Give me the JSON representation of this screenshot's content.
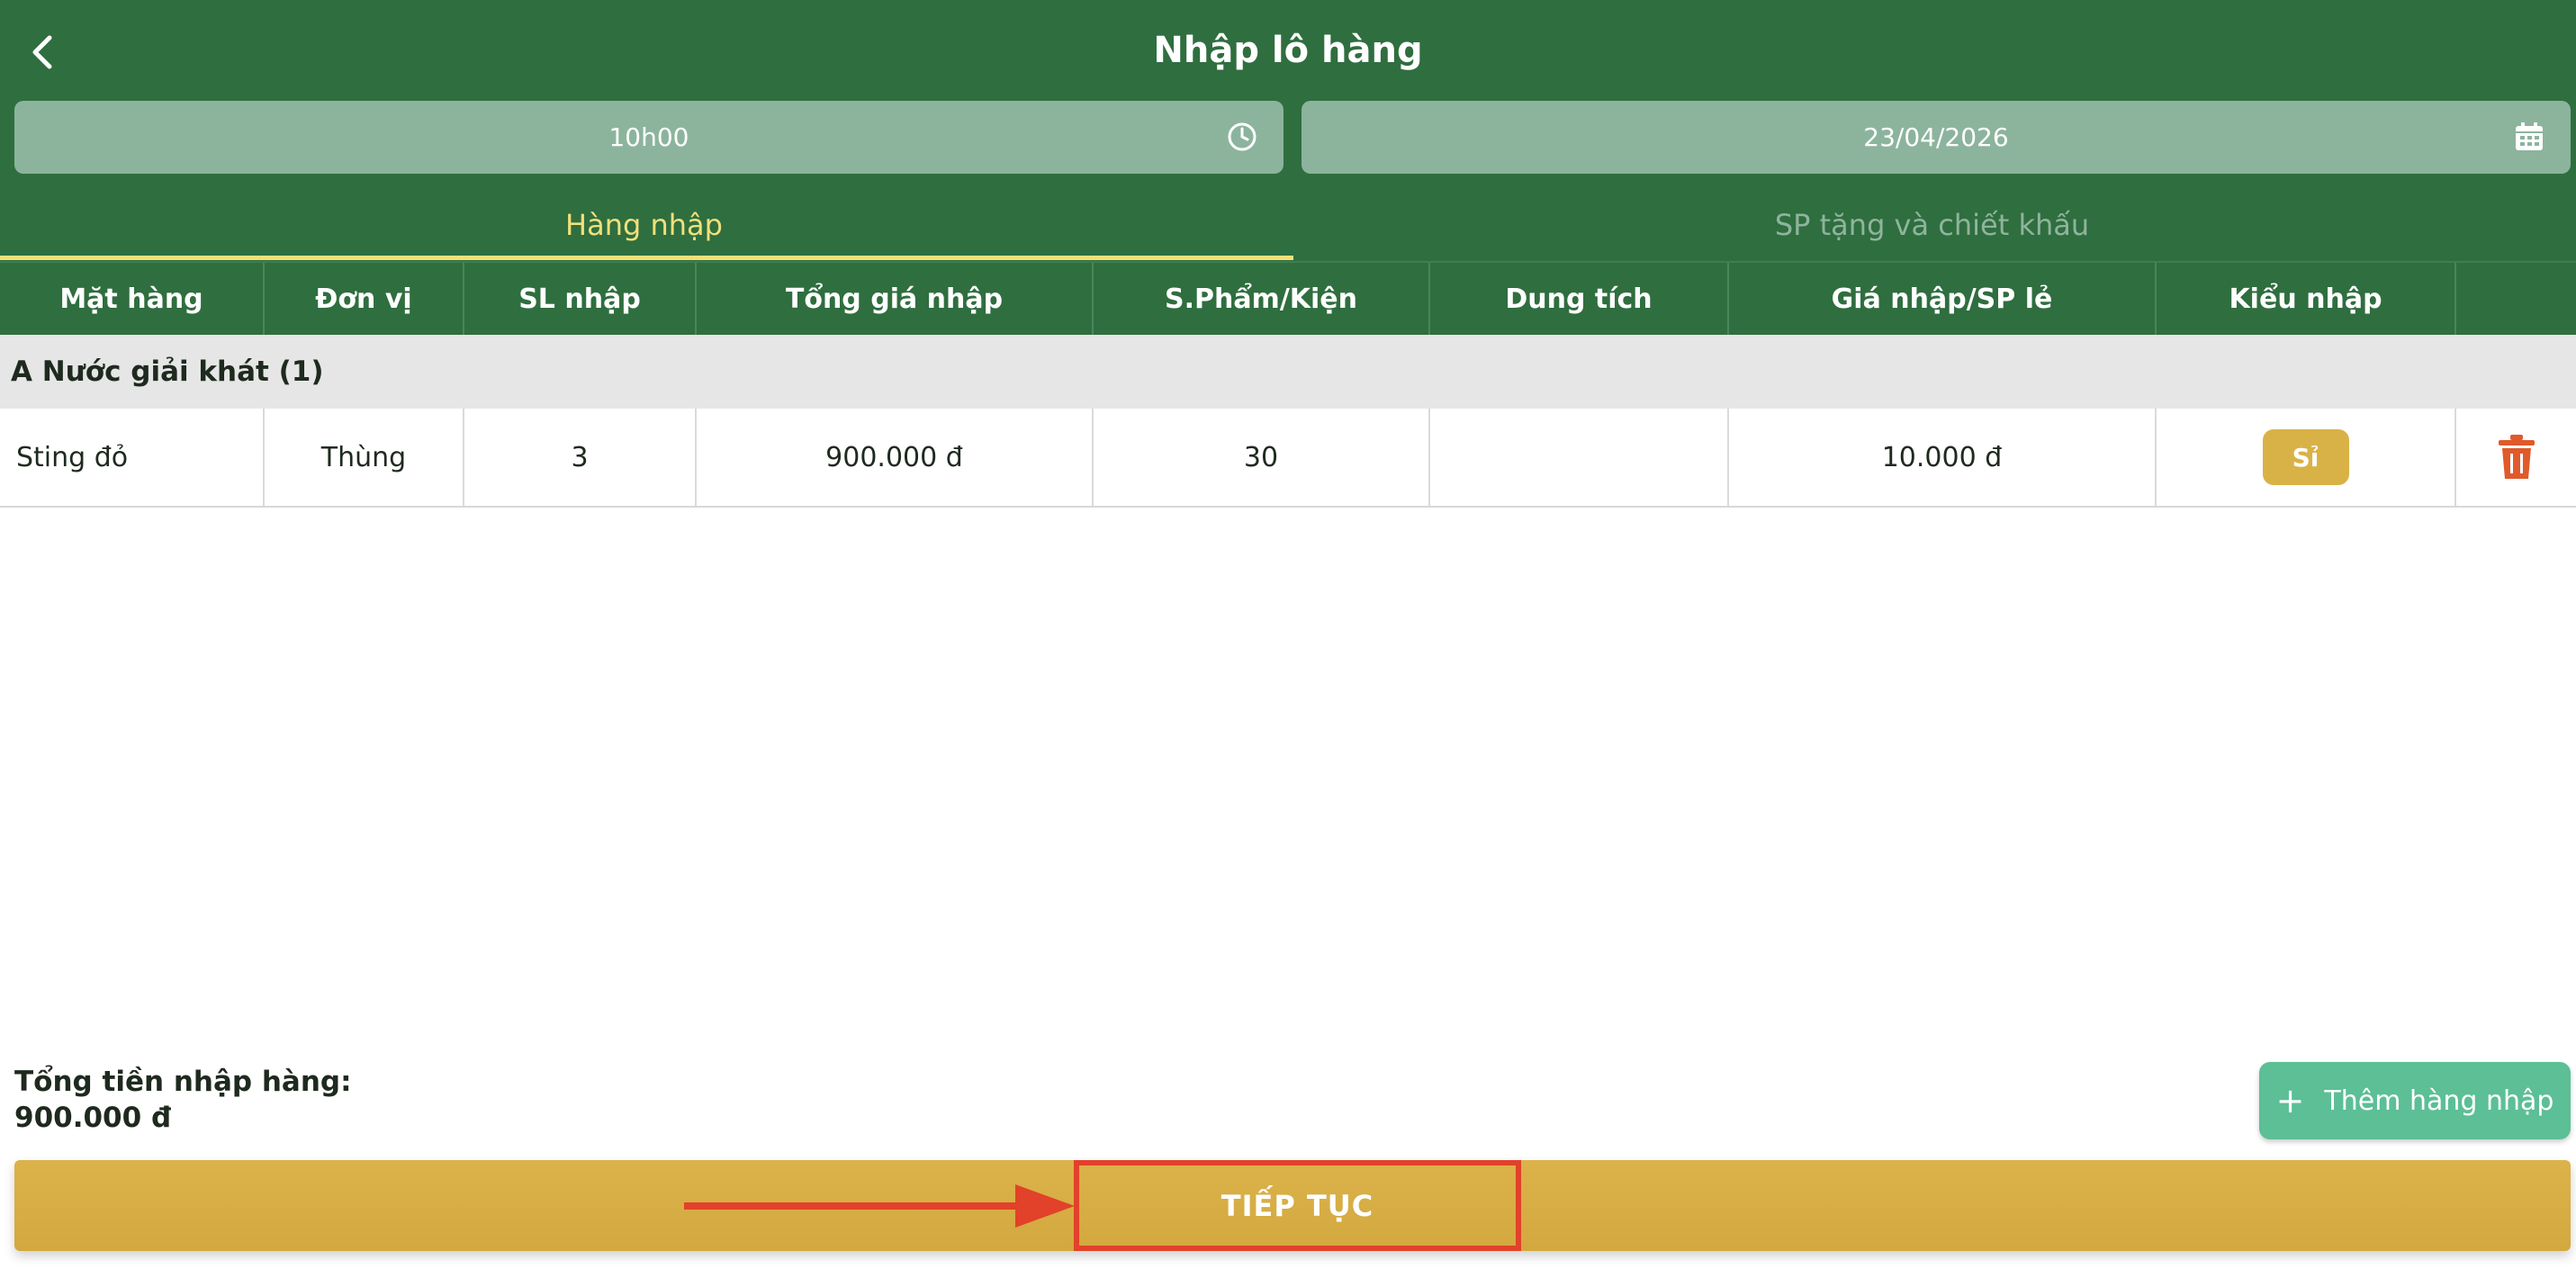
{
  "header": {
    "title": "Nhập lô hàng",
    "time_value": "10h00",
    "date_value": "23/04/2026"
  },
  "tabs": [
    {
      "label": "Hàng nhập",
      "active": true
    },
    {
      "label": "SP tặng và chiết khấu",
      "active": false
    }
  ],
  "table": {
    "columns": [
      "Mặt hàng",
      "Đơn vị",
      "SL nhập",
      "Tổng giá nhập",
      "S.Phẩm/Kiện",
      "Dung tích",
      "Giá nhập/SP lẻ",
      "Kiểu nhập",
      ""
    ],
    "group": "A Nước giải khát (1)",
    "rows": [
      {
        "item": "Sting đỏ",
        "unit": "Thùng",
        "qty": "3",
        "total": "900.000 đ",
        "per_pack": "30",
        "volume": "",
        "unit_price": "10.000 đ",
        "import_type": "Sỉ"
      }
    ]
  },
  "footer": {
    "total_label": "Tổng tiền nhập hàng:",
    "total_value": "900.000 đ",
    "add_button": "Thêm hàng nhập",
    "continue_button": "TIẾP TỤC"
  },
  "colors": {
    "primary_green": "#2f6e3f",
    "field_green": "#8cb49d",
    "active_tab": "#f1e07a",
    "accent_gold": "#d9b247",
    "add_green": "#5cbf96",
    "annotation_red": "#e2412a",
    "trash_orange": "#e05a2b"
  },
  "icons": [
    "back-arrow-icon",
    "clock-icon",
    "calendar-icon",
    "trash-icon",
    "plus-icon",
    "annotation-arrow"
  ]
}
